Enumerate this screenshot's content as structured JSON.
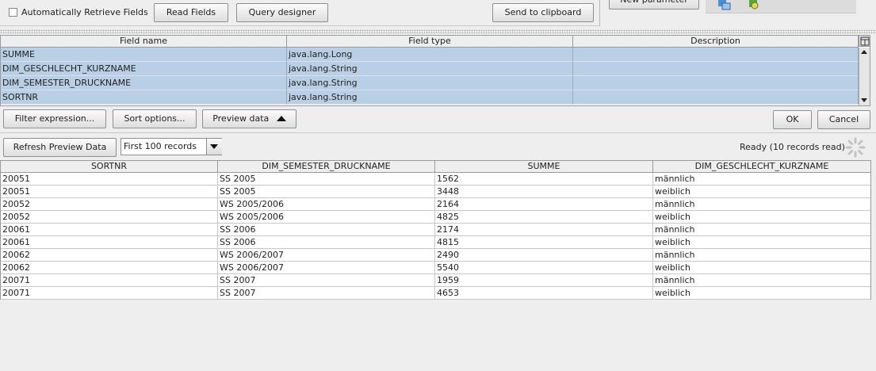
{
  "top_bar": {
    "auto_retrieve_label": "Automatically Retrieve Fields",
    "read_fields_label": "Read Fields",
    "query_designer_label": "Query designer",
    "send_to_clipboard_label": "Send to clipboard",
    "new_parameter_label": "New parameter"
  },
  "fields_table": {
    "headers": [
      "Field name",
      "Field type",
      "Description"
    ],
    "rows": [
      [
        "SUMME",
        "java.lang.Long",
        ""
      ],
      [
        "DIM_GESCHLECHT_KURZNAME",
        "java.lang.String",
        ""
      ],
      [
        "DIM_SEMESTER_DRUCKNAME",
        "java.lang.String",
        ""
      ],
      [
        "SORTNR",
        "java.lang.String",
        ""
      ]
    ]
  },
  "actions": {
    "filter_expression_label": "Filter expression...",
    "sort_options_label": "Sort options...",
    "preview_data_label": "Preview data",
    "ok_label": "OK",
    "cancel_label": "Cancel"
  },
  "preview": {
    "refresh_label": "Refresh Preview Data",
    "records_select_value": "First 100 records",
    "status_text": "Ready (10 records read)",
    "headers": [
      "SORTNR",
      "DIM_SEMESTER_DRUCKNAME",
      "SUMME",
      "DIM_GESCHLECHT_KURZNAME"
    ],
    "rows": [
      [
        "20051",
        "SS 2005",
        "1562",
        "männlich"
      ],
      [
        "20051",
        "SS 2005",
        "3448",
        "weiblich"
      ],
      [
        "20052",
        "WS 2005/2006",
        "2164",
        "männlich"
      ],
      [
        "20052",
        "WS 2005/2006",
        "4825",
        "weiblich"
      ],
      [
        "20061",
        "SS 2006",
        "2174",
        "männlich"
      ],
      [
        "20061",
        "SS 2006",
        "4815",
        "weiblich"
      ],
      [
        "20062",
        "WS 2006/2007",
        "2490",
        "männlich"
      ],
      [
        "20062",
        "WS 2006/2007",
        "5540",
        "weiblich"
      ],
      [
        "20071",
        "SS 2007",
        "1959",
        "männlich"
      ],
      [
        "20071",
        "SS 2007",
        "4653",
        "weiblich"
      ]
    ]
  }
}
